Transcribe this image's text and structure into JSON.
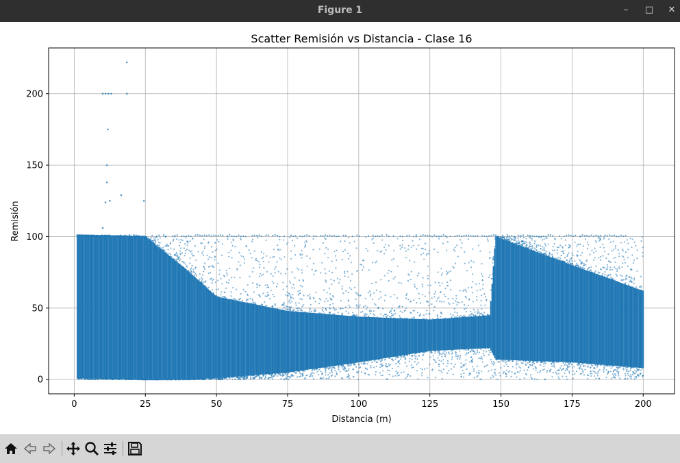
{
  "window": {
    "title": "Figure 1",
    "controls": {
      "minimize": "–",
      "maximize": "□",
      "close": "✕"
    }
  },
  "toolbar": {
    "buttons": [
      {
        "name": "home-button",
        "icon": "home-icon"
      },
      {
        "name": "back-button",
        "icon": "back-arrow-icon"
      },
      {
        "name": "forward-button",
        "icon": "forward-arrow-icon"
      },
      {
        "name": "pan-button",
        "icon": "move-icon"
      },
      {
        "name": "zoom-button",
        "icon": "magnifier-icon"
      },
      {
        "name": "configure-subplots-button",
        "icon": "sliders-icon"
      },
      {
        "name": "save-button",
        "icon": "floppy-disk-icon"
      }
    ]
  },
  "chart_data": {
    "type": "scatter",
    "title": "Scatter Remisión vs Distancia - Clase 16",
    "xlabel": "Distancia (m)",
    "ylabel": "Remisión",
    "xlim": [
      -9,
      211
    ],
    "ylim": [
      -10,
      232
    ],
    "xticks": [
      0,
      25,
      50,
      75,
      100,
      125,
      150,
      175,
      200
    ],
    "yticks": [
      0,
      50,
      100,
      150,
      200
    ],
    "grid": true,
    "color": "#1f77b4",
    "dense_envelope": [
      {
        "x": 1,
        "low": 1,
        "high": 101
      },
      {
        "x": 25,
        "low": 0,
        "high": 100
      },
      {
        "x": 40,
        "low": 0,
        "high": 76
      },
      {
        "x": 50,
        "low": 1,
        "high": 58
      },
      {
        "x": 75,
        "low": 5,
        "high": 48
      },
      {
        "x": 100,
        "low": 12,
        "high": 44
      },
      {
        "x": 125,
        "low": 20,
        "high": 42
      },
      {
        "x": 146,
        "low": 22,
        "high": 45
      },
      {
        "x": 148,
        "low": 14,
        "high": 100
      },
      {
        "x": 175,
        "low": 12,
        "high": 80
      },
      {
        "x": 200,
        "low": 8,
        "high": 62
      }
    ],
    "outliers": [
      {
        "x": 18.5,
        "y": 222
      },
      {
        "x": 10,
        "y": 200
      },
      {
        "x": 11,
        "y": 200
      },
      {
        "x": 12,
        "y": 200
      },
      {
        "x": 13,
        "y": 200
      },
      {
        "x": 18.5,
        "y": 200
      },
      {
        "x": 11.8,
        "y": 175
      },
      {
        "x": 11.5,
        "y": 150
      },
      {
        "x": 11.5,
        "y": 138
      },
      {
        "x": 16.5,
        "y": 129
      },
      {
        "x": 12.5,
        "y": 125
      },
      {
        "x": 11,
        "y": 124
      },
      {
        "x": 24.5,
        "y": 125
      },
      {
        "x": 10,
        "y": 106
      }
    ]
  }
}
